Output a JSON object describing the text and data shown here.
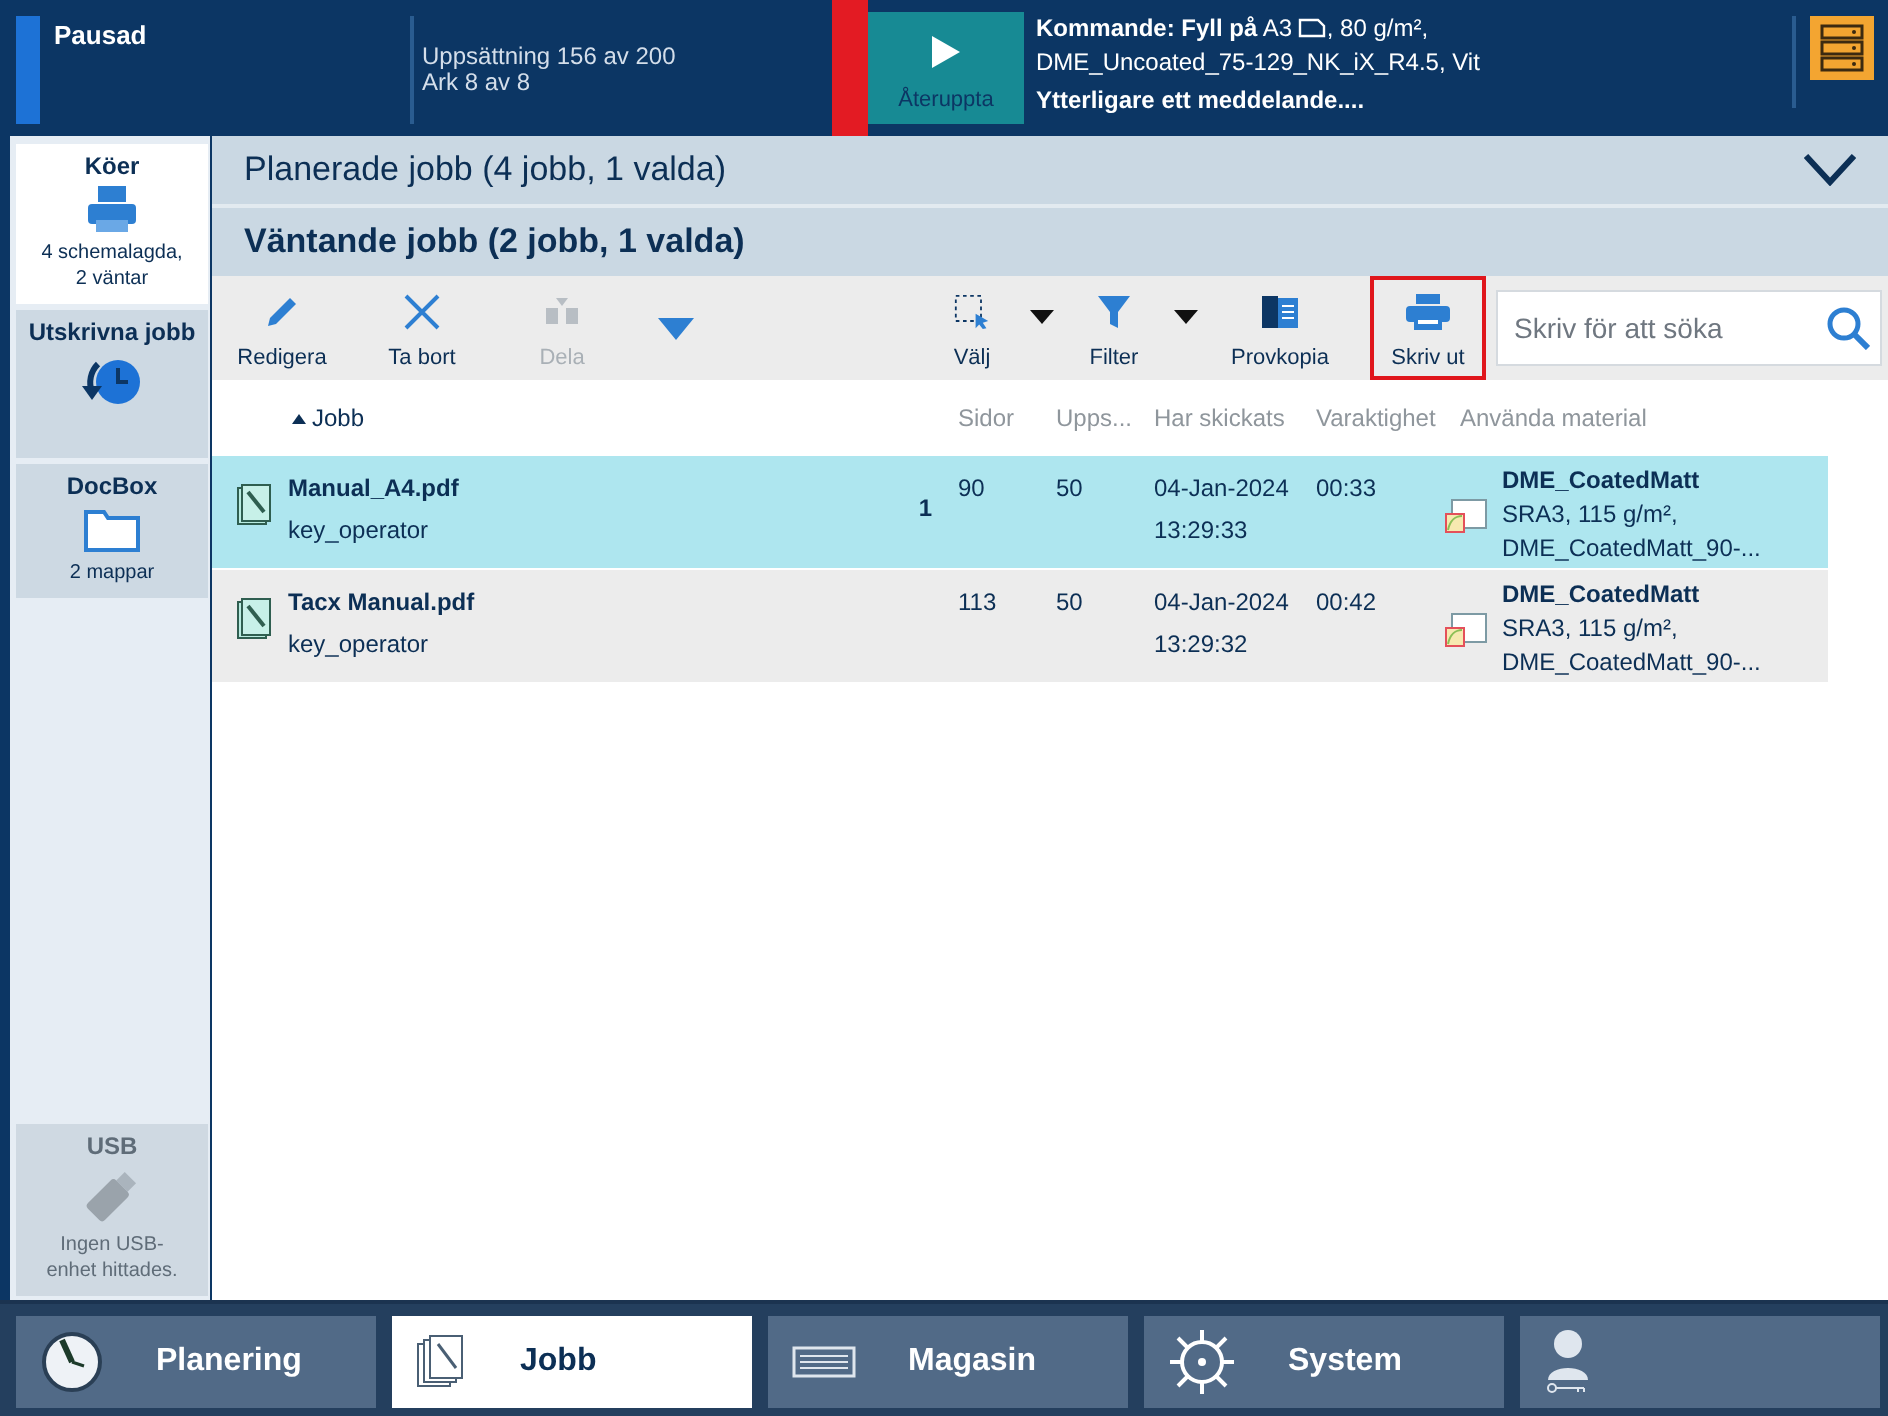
{
  "status": {
    "state": "Pausad",
    "progress": [
      "Uppsättning 156 av 200",
      "Ark 8 av 8"
    ],
    "resume_button": "Återuppta",
    "message": {
      "line1": "**Kommande: Fyll på** A3",
      "line1_rest": ", 80 g/m²,",
      "line2": "DME_Uncoated_75-129_NK_iX_R4.5, Vit",
      "line3": "Ytterligare ett meddelande...."
    }
  },
  "sidebar": {
    "items": [
      {
        "title": "Köer",
        "subtitle": "4 schemalagda, 2 väntar",
        "selected": true,
        "disabled": false
      },
      {
        "title": "Utskrivna jobb",
        "selected": false,
        "disabled": false
      },
      {
        "title": "DocBox",
        "subtitle": "2 mappar",
        "selected": false,
        "disabled": false
      },
      {
        "title": "USB",
        "subtitle": "Ingen USB-enhet hittades.",
        "selected": false,
        "disabled": true
      }
    ]
  },
  "scheduled_header": {
    "title": "Planerade jobb (4 jobb, 1 valda)",
    "expanded": false
  },
  "waiting_header": {
    "title": "Väntande jobb (2 jobb, 1 valda)"
  },
  "toolbar": {
    "items": [
      {
        "kind": "button",
        "label": "Redigera",
        "disabled": false,
        "highlighted": false,
        "dropdown": false
      },
      {
        "kind": "button",
        "label": "Ta bort",
        "disabled": false,
        "highlighted": false,
        "dropdown": false
      },
      {
        "kind": "button",
        "label": "Dela",
        "disabled": true,
        "highlighted": false,
        "dropdown": false
      },
      {
        "kind": "more"
      },
      {
        "kind": "button",
        "label": "Välj",
        "disabled": false,
        "highlighted": false,
        "dropdown": true
      },
      {
        "kind": "button",
        "label": "Filter",
        "disabled": false,
        "highlighted": false,
        "dropdown": true
      },
      {
        "kind": "button",
        "label": "Provkopia",
        "disabled": false,
        "highlighted": false,
        "dropdown": false
      },
      {
        "kind": "button",
        "label": "Skriv ut",
        "disabled": false,
        "highlighted": true,
        "dropdown": false
      }
    ],
    "search": {
      "placeholder": "Skriv för att söka"
    }
  },
  "table": {
    "columns": [
      {
        "label": "Jobb",
        "sorted": true
      },
      {
        "label": "Sidor"
      },
      {
        "label": "Upps..."
      },
      {
        "label": "Har skickats"
      },
      {
        "label": "Varaktighet"
      },
      {
        "label": "Använda material"
      }
    ],
    "rows": [
      {
        "name": "Manual_A4.pdf",
        "owner": "key_operator",
        "marker": "1",
        "pages": "90",
        "copies": "50",
        "sent_date": "04-Jan-2024",
        "sent_time": "13:29:33",
        "duration": "00:33",
        "material": [
          "DME_CoatedMatt",
          "SRA3, 115 g/m²,",
          "DME_CoatedMatt_90-..."
        ],
        "selected": true
      },
      {
        "name": "Tacx Manual.pdf",
        "owner": "key_operator",
        "pages": "113",
        "copies": "50",
        "sent_date": "04-Jan-2024",
        "sent_time": "13:29:32",
        "duration": "00:42",
        "material": [
          "DME_CoatedMatt",
          "SRA3, 115 g/m²,",
          "DME_CoatedMatt_90-..."
        ],
        "selected": false
      }
    ]
  },
  "tabs": [
    {
      "label": "Planering",
      "selected": false
    },
    {
      "label": "Jobb",
      "selected": true
    },
    {
      "label": "Magasin",
      "selected": false
    },
    {
      "label": "System",
      "selected": false
    },
    {
      "selected": false
    }
  ]
}
